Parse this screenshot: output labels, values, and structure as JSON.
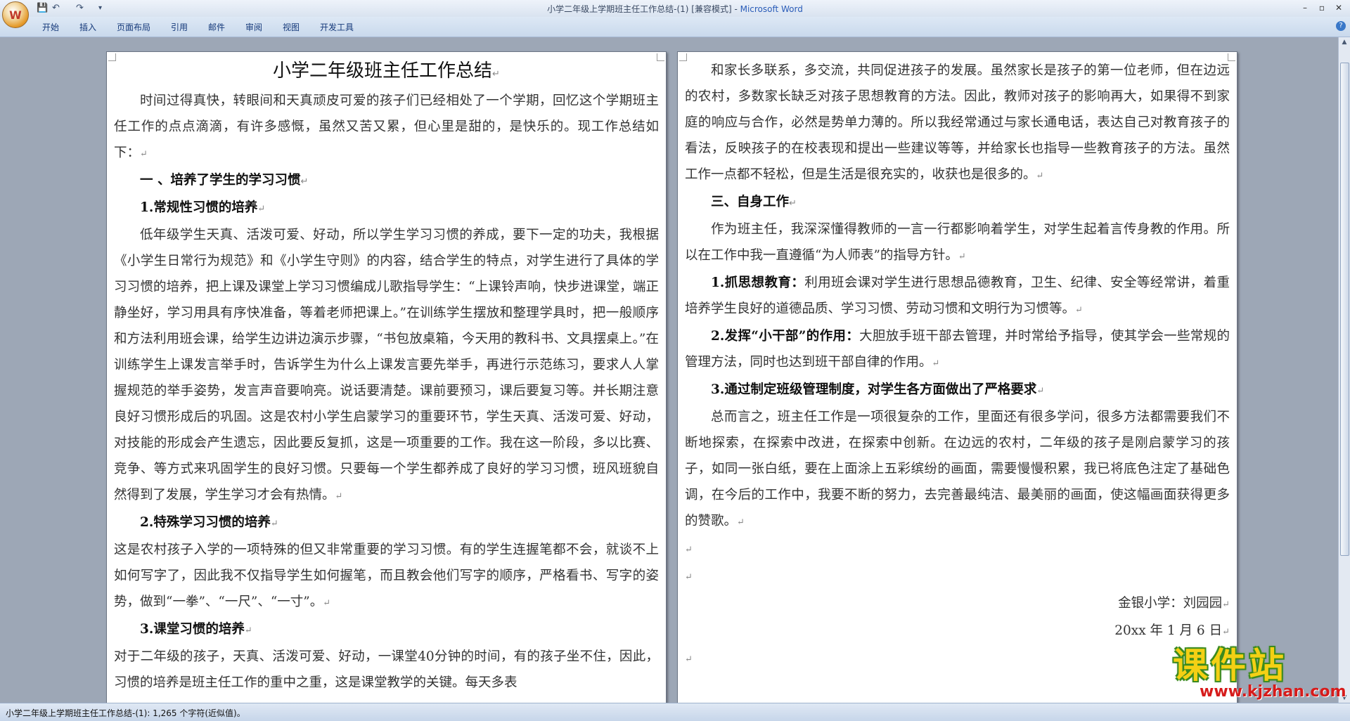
{
  "window": {
    "title": "小学二年级上学期班主任工作总结-(1) [兼容模式] - ",
    "app_name": "Microsoft Word",
    "minimize": "–",
    "maximize": "▫",
    "close": "✕"
  },
  "quick_access": {
    "save": "💾",
    "undo": "↶",
    "redo": "↷",
    "customize": "▾"
  },
  "ribbon": {
    "tabs": [
      "开始",
      "插入",
      "页面布局",
      "引用",
      "邮件",
      "审阅",
      "视图",
      "开发工具"
    ],
    "help": "?"
  },
  "document": {
    "left_page": {
      "title": "小学二年级班主任工作总结",
      "intro": "时间过得真快，转眼间和天真顽皮可爱的孩子们已经相处了一个学期，回忆这个学期班主任工作的点点滴滴，有许多感慨，虽然又苦又累，但心里是甜的，是快乐的。现工作总结如下：",
      "section1": "一 、培养了学生的学习习惯",
      "sub1": "1.常规性习惯的培养",
      "para1": "低年级学生天真、活泼可爱、好动，所以学生学习习惯的养成，要下一定的功夫，我根据《小学生日常行为规范》和《小学生守则》的内容，结合学生的特点，对学生进行了具体的学习习惯的培养，把上课及课堂上学习习惯编成儿歌指导学生：“上课铃声响，快步进课堂，端正静坐好，学习用具有序快准备，等着老师把课上。”在训练学生摆放和整理学具时，把一般顺序和方法利用班会课，给学生边讲边演示步骤，“书包放桌箱，今天用的教科书、文具摆桌上。”在训练学生上课发言举手时，告诉学生为什么上课发言要先举手，再进行示范练习，要求人人掌握规范的举手姿势，发言声音要响亮。说话要清楚。课前要预习，课后要复习等。并长期注意良好习惯形成后的巩固。这是农村小学生启蒙学习的重要环节，学生天真、活泼可爱、好动，对技能的形成会产生遗忘，因此要反复抓，这是一项重要的工作。我在这一阶段，多以比赛、竞争、等方式来巩固学生的良好习惯。只要每一个学生都养成了良好的学习习惯，班风班貌自然得到了发展，学生学习才会有热情。",
      "sub2": "2.特殊学习习惯的培养",
      "para2": "这是农村孩子入学的一项特殊的但又非常重要的学习习惯。有的学生连握笔都不会，就谈不上如何写字了，因此我不仅指导学生如何握笔，而且教会他们写字的顺序，严格看书、写字的姿势，做到“一拳”、“一尺”、“一寸”。",
      "sub3": "3.课堂习惯的培养",
      "para3": "对于二年级的孩子，天真、活泼可爱、好动，一课堂40分钟的时间，有的孩子坐不住，因此，习惯的培养是班主任工作的重中之重，这是课堂教学的关键。每天多表"
    },
    "right_page": {
      "para_cont": "和家长多联系，多交流，共同促进孩子的发展。虽然家长是孩子的第一位老师，但在边远的农村，多数家长缺乏对孩子思想教育的方法。因此，教师对孩子的影响再大，如果得不到家庭的响应与合作，必然是势单力薄的。所以我经常通过与家长通电话，表达自己对教育孩子的看法，反映孩子的在校表现和提出一些建议等等，并给家长也指导一些教育孩子的方法。虽然工作一点都不轻松，但是生活是很充实的，收获也是很多的。",
      "section3": "三、自身工作",
      "para_role": "作为班主任，我深深懂得教师的一言一行都影响着学生，对学生起着言传身教的作用。所以在工作中我一直遵循“为人师表”的指导方针。",
      "item1_head": "1.抓思想教育：",
      "item1_body": "利用班会课对学生进行思想品德教育，卫生、纪律、安全等经常讲，着重培养学生良好的道德品质、学习习惯、劳动习惯和文明行为习惯等。",
      "item2_head": "2.发挥“小干部”的作用：",
      "item2_body": "大胆放手班干部去管理，并时常给予指导，使其学会一些常规的管理方法，同时也达到班干部自律的作用。",
      "item3_head": "3.通过制定班级管理制度，对学生各方面做出了严格要求",
      "conclusion": "总而言之，班主任工作是一项很复杂的工作，里面还有很多学问，很多方法都需要我们不断地探索，在探索中改进，在探索中创新。在边远的农村，二年级的孩子是刚启蒙学习的孩子，如同一张白纸，要在上面涂上五彩缤纷的画面，需要慢慢积累，我已将底色注定了基础色调，在今后的工作中，我要不断的努力，去完善最纯洁、最美丽的画面，使这幅画面获得更多的赞歌。",
      "signature": "金银小学：刘园园",
      "date": "20xx 年 1 月 6 日"
    },
    "paragraph_mark": "↵"
  },
  "watermark": {
    "cn": "课件站",
    "url": "www.kjzhan.com"
  },
  "status_bar": {
    "text": "小学二年级上学期班主任工作总结-(1): 1,265 个字符(近似值)。"
  },
  "colors": {
    "workspace": "#9da7b6",
    "ribbon": "#c9d9ec",
    "app_name": "#2a5cb8"
  }
}
